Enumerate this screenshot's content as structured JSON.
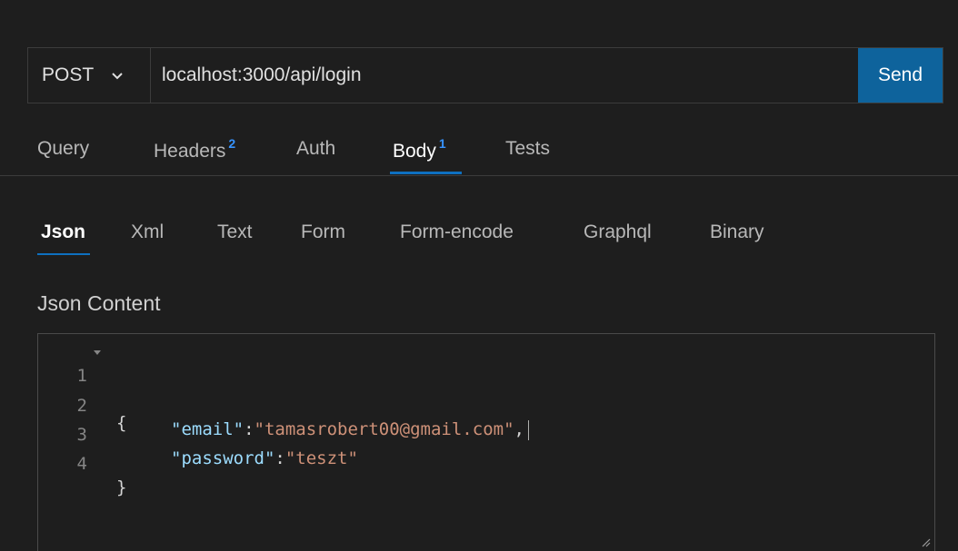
{
  "request": {
    "method": "POST",
    "url": "localhost:3000/api/login",
    "send_label": "Send"
  },
  "tabs": [
    {
      "label": "Query",
      "badge": ""
    },
    {
      "label": "Headers",
      "badge": "2"
    },
    {
      "label": "Auth",
      "badge": ""
    },
    {
      "label": "Body",
      "badge": "1"
    },
    {
      "label": "Tests",
      "badge": ""
    }
  ],
  "body_tabs": [
    "Json",
    "Xml",
    "Text",
    "Form",
    "Form-encode",
    "Graphql",
    "Binary"
  ],
  "editor": {
    "label": "Json Content",
    "lines": [
      {
        "num": "1",
        "text": "{"
      },
      {
        "num": "2",
        "key": "\"email\"",
        "sep": ":",
        "value": "\"tamasrobert00@gmail.com\"",
        "tail": ","
      },
      {
        "num": "3",
        "key": "\"password\"",
        "sep": ":",
        "value": "\"teszt\"",
        "tail": ""
      },
      {
        "num": "4",
        "text": "}"
      }
    ]
  },
  "colors": {
    "accent": "#0e639c",
    "badge": "#3794ff",
    "json_key": "#9cdcfe",
    "json_string": "#ce9178"
  }
}
